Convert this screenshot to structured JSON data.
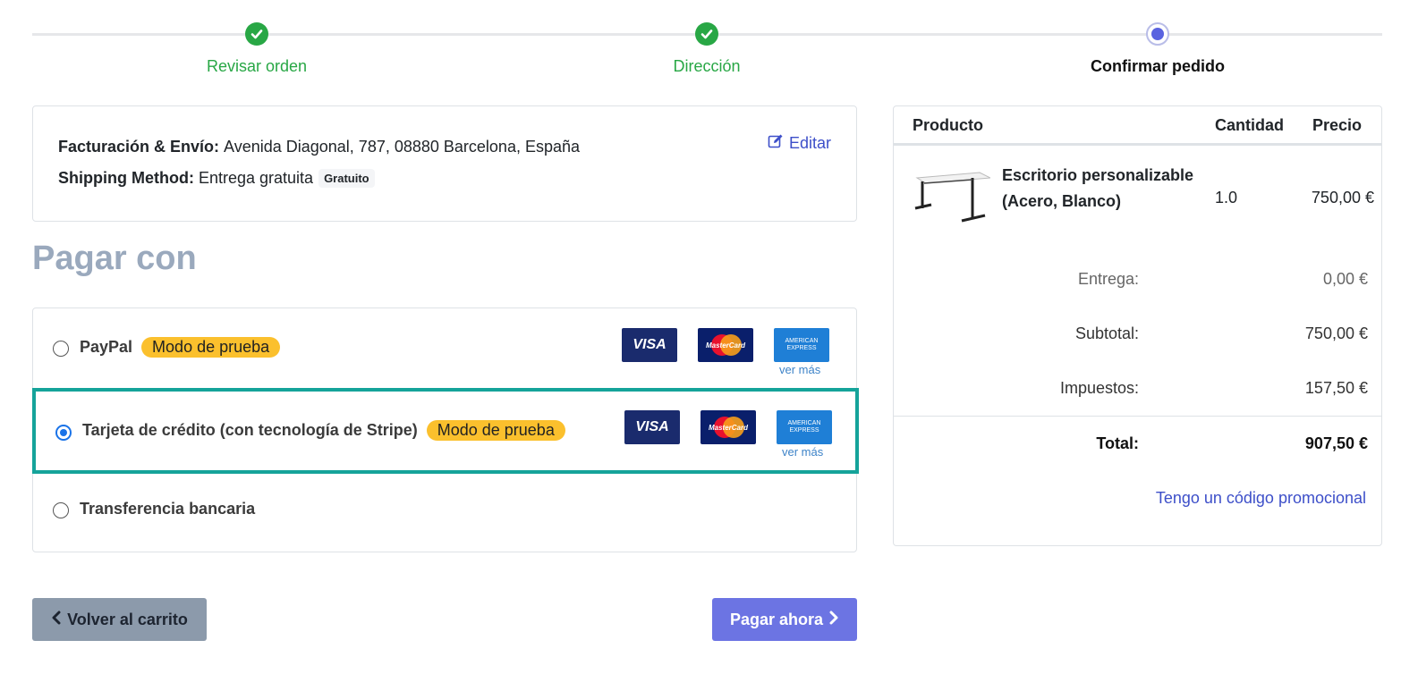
{
  "steps": [
    {
      "label": "Revisar orden",
      "state": "done"
    },
    {
      "label": "Dirección",
      "state": "done"
    },
    {
      "label": "Confirmar pedido",
      "state": "current"
    }
  ],
  "address": {
    "billing_label": "Facturación & Envío:",
    "billing_value": "Avenida Diagonal, 787, 08880 Barcelona, España",
    "shipping_label": "Shipping Method:",
    "shipping_value": "Entrega gratuita",
    "shipping_badge": "Gratuito",
    "edit_label": "Editar"
  },
  "payment": {
    "title": "Pagar con",
    "options": [
      {
        "label": "PayPal",
        "badge": "Modo de prueba",
        "selected": false,
        "cards": [
          "VISA",
          "MasterCard",
          "AMERICAN EXPRESS"
        ],
        "more": "ver más"
      },
      {
        "label": "Tarjeta de crédito (con tecnología de Stripe)",
        "badge": "Modo de prueba",
        "selected": true,
        "cards": [
          "VISA",
          "MasterCard",
          "AMERICAN EXPRESS"
        ],
        "more": "ver más"
      },
      {
        "label": "Transferencia bancaria",
        "selected": false
      }
    ]
  },
  "buttons": {
    "back": "Volver al carrito",
    "pay": "Pagar ahora"
  },
  "summary": {
    "headers": {
      "product": "Producto",
      "quantity": "Cantidad",
      "price": "Precio"
    },
    "item": {
      "name": "Escritorio personalizable (Acero, Blanco)",
      "quantity": "1.0",
      "price": "750,00 €"
    },
    "delivery_label": "Entrega:",
    "delivery_value": "0,00 €",
    "subtotal_label": "Subtotal:",
    "subtotal_value": "750,00 €",
    "taxes_label": "Impuestos:",
    "taxes_value": "157,50 €",
    "total_label": "Total:",
    "total_value": "907,50 €",
    "promo_label": "Tengo un código promocional"
  },
  "colors": {
    "done": "#28a745",
    "current": "#5a63e0",
    "selected_border": "#15a39a",
    "test_badge": "#fbc02d",
    "link": "#3d4fc9",
    "pay_button": "#6c74e3",
    "back_button": "#8c9aab"
  }
}
